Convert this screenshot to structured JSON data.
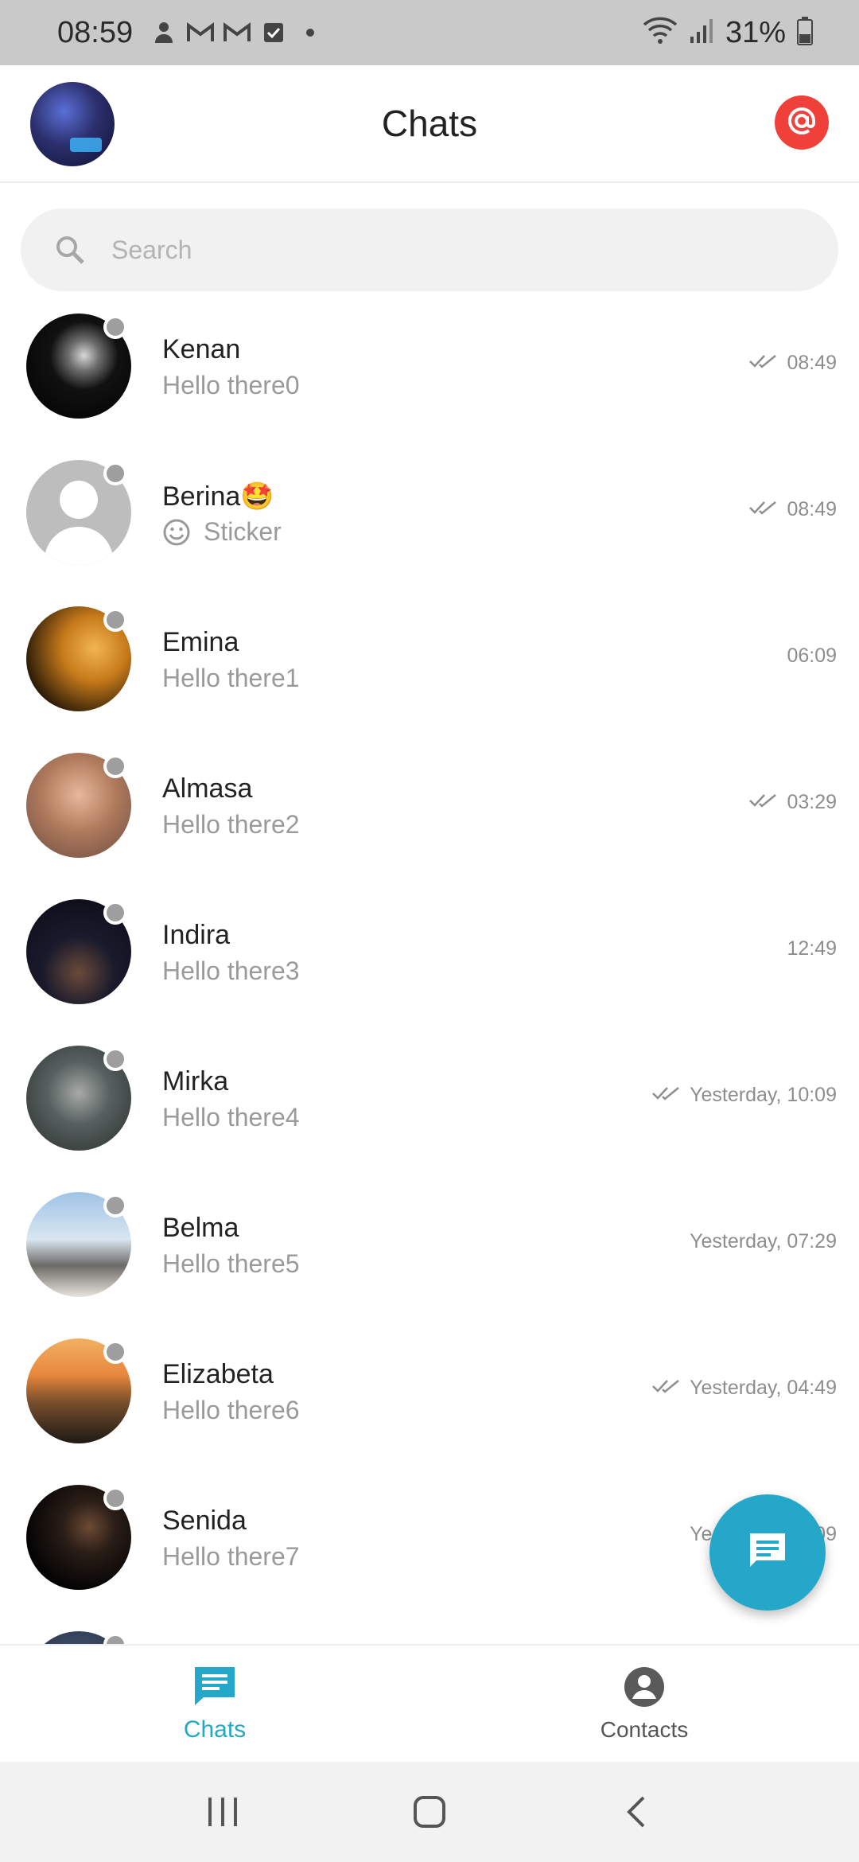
{
  "status_bar": {
    "time": "08:59",
    "battery": "31%",
    "left_icons": [
      "shield-person-icon",
      "gmail-icon",
      "gmail-icon",
      "checkbox-icon",
      "dot-icon"
    ],
    "right_icons": [
      "wifi-icon",
      "signal-icon",
      "battery-icon"
    ]
  },
  "header": {
    "title": "Chats",
    "mention_button_icon": "at-sign-icon",
    "accent": "#f0403a"
  },
  "search": {
    "placeholder": "Search"
  },
  "chats": [
    {
      "name": "Kenan",
      "preview": "Hello there0",
      "time": "08:49",
      "read": true
    },
    {
      "name": "Berina🤩",
      "preview": "Sticker",
      "preview_icon": "smiley-icon",
      "time": "08:49",
      "read": true
    },
    {
      "name": "Emina",
      "preview": "Hello there1",
      "time": "06:09",
      "read": false
    },
    {
      "name": "Almasa",
      "preview": "Hello there2",
      "time": "03:29",
      "read": true
    },
    {
      "name": "Indira",
      "preview": "Hello there3",
      "time": "12:49",
      "read": false
    },
    {
      "name": "Mirka",
      "preview": "Hello there4",
      "time": "Yesterday, 10:09",
      "read": true
    },
    {
      "name": "Belma",
      "preview": "Hello there5",
      "time": "Yesterday, 07:29",
      "read": false
    },
    {
      "name": "Elizabeta",
      "preview": "Hello there6",
      "time": "Yesterday, 04:49",
      "read": true
    },
    {
      "name": "Senida",
      "preview": "Hello there7",
      "time": "Yesterday, 02:09",
      "read": false
    }
  ],
  "fab": {
    "icon": "message-icon",
    "color": "#24a7c8"
  },
  "bottom_nav": [
    {
      "label": "Chats",
      "icon": "chat-icon",
      "active": true
    },
    {
      "label": "Contacts",
      "icon": "account-circle-icon",
      "active": false
    }
  ],
  "system_nav": [
    "recents-icon",
    "home-icon",
    "back-icon"
  ]
}
